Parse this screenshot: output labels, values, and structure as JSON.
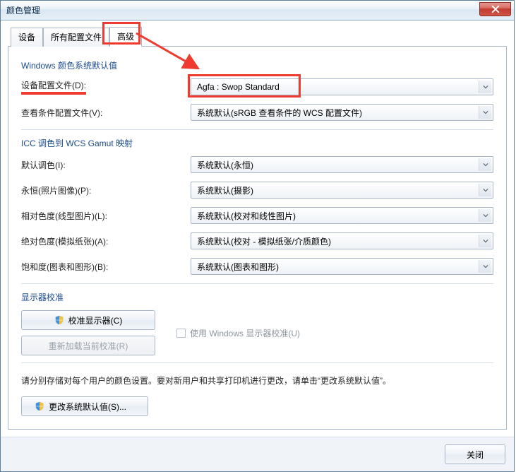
{
  "window": {
    "title": "颜色管理"
  },
  "tabs": {
    "device": "设备",
    "all_profiles": "所有配置文件",
    "advanced": "高级"
  },
  "group_default": {
    "title": "Windows 颜色系统默认值",
    "device_profile_label": "设备配置文件(D):",
    "device_profile_value": "Agfa : Swop Standard",
    "view_cond_label": "查看条件配置文件(V):",
    "view_cond_value": "系统默认(sRGB 查看条件的 WCS 配置文件)"
  },
  "group_icc": {
    "title": "ICC 调色到 WCS Gamut 映射",
    "default_intent_label": "默认调色(I):",
    "default_intent_value": "系统默认(永恒)",
    "perceptual_label": "永恒(照片图像)(P):",
    "perceptual_value": "系统默认(摄影)",
    "relative_label": "相对色度(线型图片)(L):",
    "relative_value": "系统默认(校对和线性图片)",
    "absolute_label": "绝对色度(模拟纸张)(A):",
    "absolute_value": "系统默认(校对 - 模拟纸张/介质颜色)",
    "saturation_label": "饱和度(图表和图形)(B):",
    "saturation_value": "系统默认(图表和图形)"
  },
  "group_calib": {
    "title": "显示器校准",
    "calibrate_btn": "校准显示器(C)",
    "reload_btn": "重新加载当前校准(R)",
    "use_win_calib": "使用 Windows 显示器校准(U)"
  },
  "info_line": "请分别存储对每个用户的颜色设置。要对新用户和共享打印机进行更改，请单击“更改系统默认值”。",
  "change_defaults_btn": "更改系统默认值(S)...",
  "footer": {
    "close": "关闭"
  }
}
